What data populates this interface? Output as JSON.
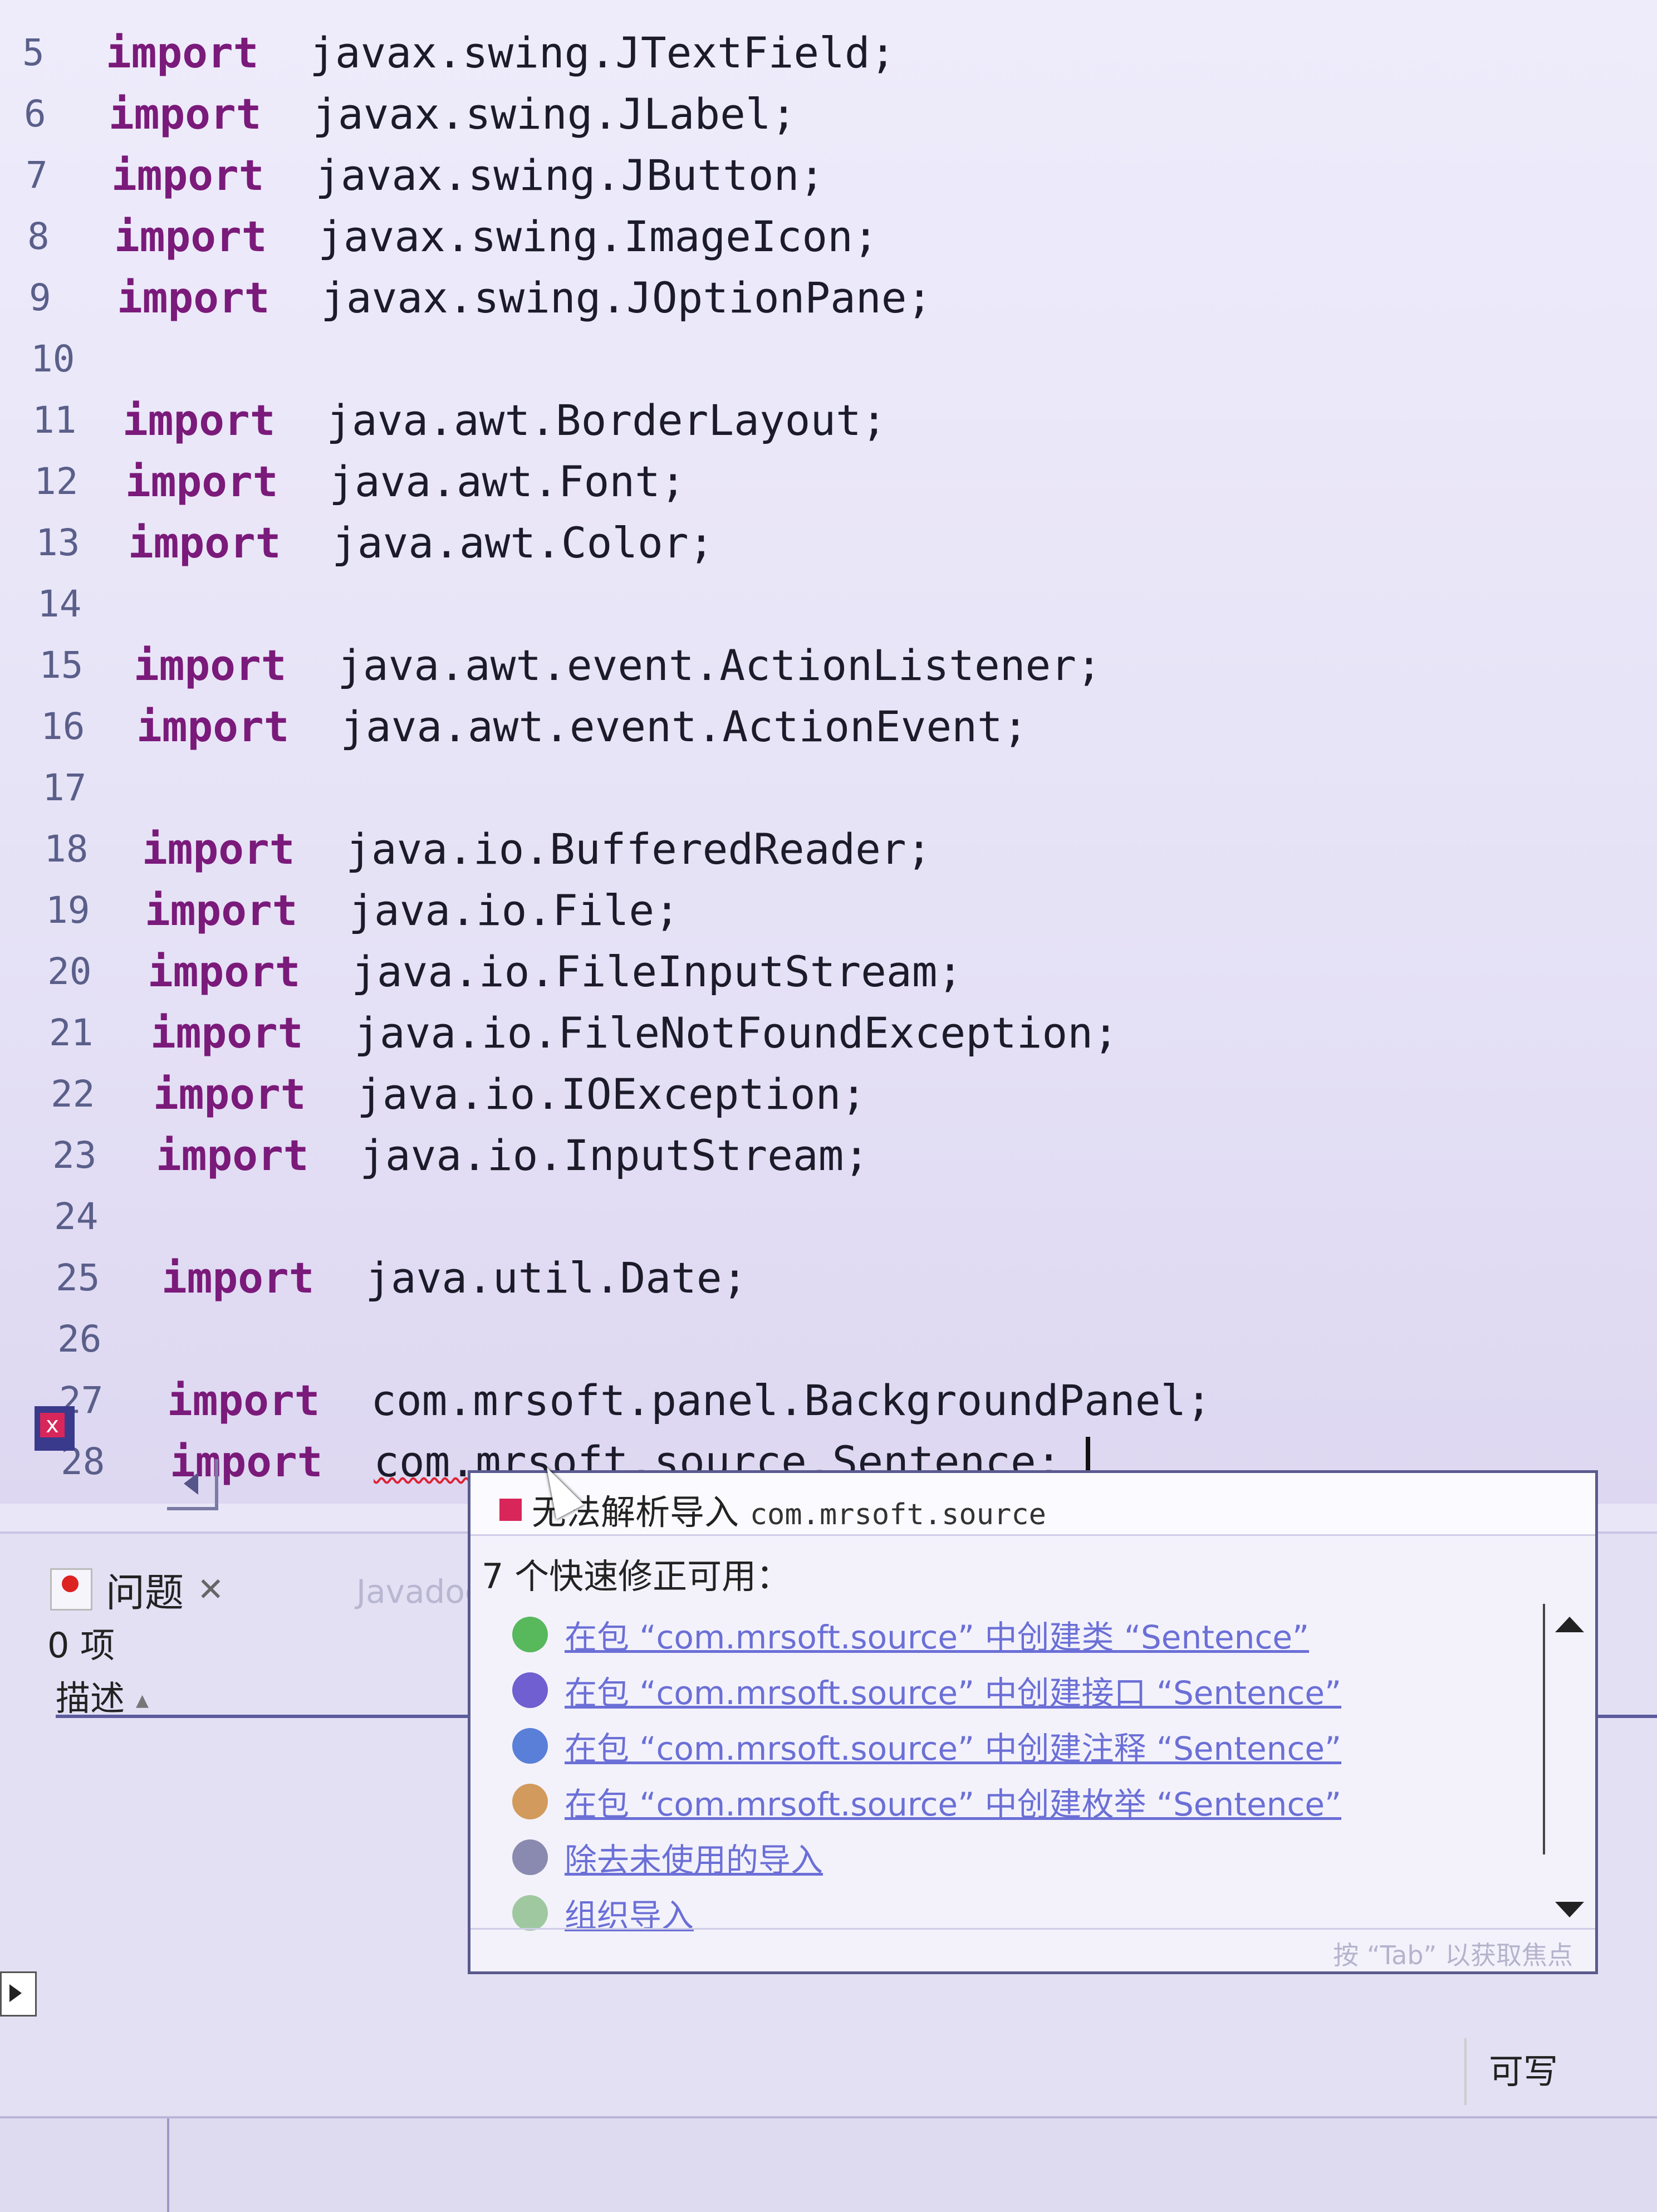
{
  "editor": {
    "lines": [
      {
        "num": "5",
        "kw": "import",
        "code": "javax.swing.JTextField;"
      },
      {
        "num": "6",
        "kw": "import",
        "code": "javax.swing.JLabel;"
      },
      {
        "num": "7",
        "kw": "import",
        "code": "javax.swing.JButton;"
      },
      {
        "num": "8",
        "kw": "import",
        "code": "javax.swing.ImageIcon;"
      },
      {
        "num": "9",
        "kw": "import",
        "code": "javax.swing.JOptionPane;"
      },
      {
        "num": "10",
        "kw": "",
        "code": ""
      },
      {
        "num": "11",
        "kw": "import",
        "code": "java.awt.BorderLayout;"
      },
      {
        "num": "12",
        "kw": "import",
        "code": "java.awt.Font;"
      },
      {
        "num": "13",
        "kw": "import",
        "code": "java.awt.Color;"
      },
      {
        "num": "14",
        "kw": "",
        "code": ""
      },
      {
        "num": "15",
        "kw": "import",
        "code": "java.awt.event.ActionListener;"
      },
      {
        "num": "16",
        "kw": "import",
        "code": "java.awt.event.ActionEvent;"
      },
      {
        "num": "17",
        "kw": "",
        "code": ""
      },
      {
        "num": "18",
        "kw": "import",
        "code": "java.io.BufferedReader;"
      },
      {
        "num": "19",
        "kw": "import",
        "code": "java.io.File;"
      },
      {
        "num": "20",
        "kw": "import",
        "code": "java.io.FileInputStream;"
      },
      {
        "num": "21",
        "kw": "import",
        "code": "java.io.FileNotFoundException;"
      },
      {
        "num": "22",
        "kw": "import",
        "code": "java.io.IOException;"
      },
      {
        "num": "23",
        "kw": "import",
        "code": "java.io.InputStream;"
      },
      {
        "num": "24",
        "kw": "",
        "code": ""
      },
      {
        "num": "25",
        "kw": "import",
        "code": "java.util.Date;"
      },
      {
        "num": "26",
        "kw": "",
        "code": ""
      },
      {
        "num": "27",
        "kw": "import",
        "code": "com.mrsoft.panel.BackgroundPanel;"
      },
      {
        "num": "28",
        "kw": "import",
        "code": "com.mrsoft.source.Sentence;"
      }
    ]
  },
  "problems": {
    "tab_label": "问题",
    "close_glyph": "✕",
    "javadoc_tab": "Javadoc",
    "item_count": "0 项",
    "column_description": "描述"
  },
  "quickfix": {
    "title": "无法解析导入",
    "title_package": "com.mrsoft.source",
    "count_label": "7 个快速修正可用：",
    "items": [
      {
        "label": "在包 “com.mrsoft.source” 中创建类 “Sentence”",
        "icon": "class-icon",
        "color": "#58b85c"
      },
      {
        "label": "在包 “com.mrsoft.source” 中创建接口 “Sentence”",
        "icon": "interface-icon",
        "color": "#6f5fd0"
      },
      {
        "label": "在包 “com.mrsoft.source” 中创建注释 “Sentence”",
        "icon": "annotation-icon",
        "color": "#5a7fd8"
      },
      {
        "label": "在包 “com.mrsoft.source” 中创建枚举 “Sentence”",
        "icon": "enum-icon",
        "color": "#d29a5c"
      },
      {
        "label": "除去未使用的导入",
        "icon": "remove-import-icon",
        "color": "#8a8ab0"
      },
      {
        "label": "组织导入",
        "icon": "organize-imports-icon",
        "color": "#a0c8a0"
      }
    ],
    "footer": "按 “Tab” 以获取焦点"
  },
  "status": {
    "writable": "可写"
  }
}
